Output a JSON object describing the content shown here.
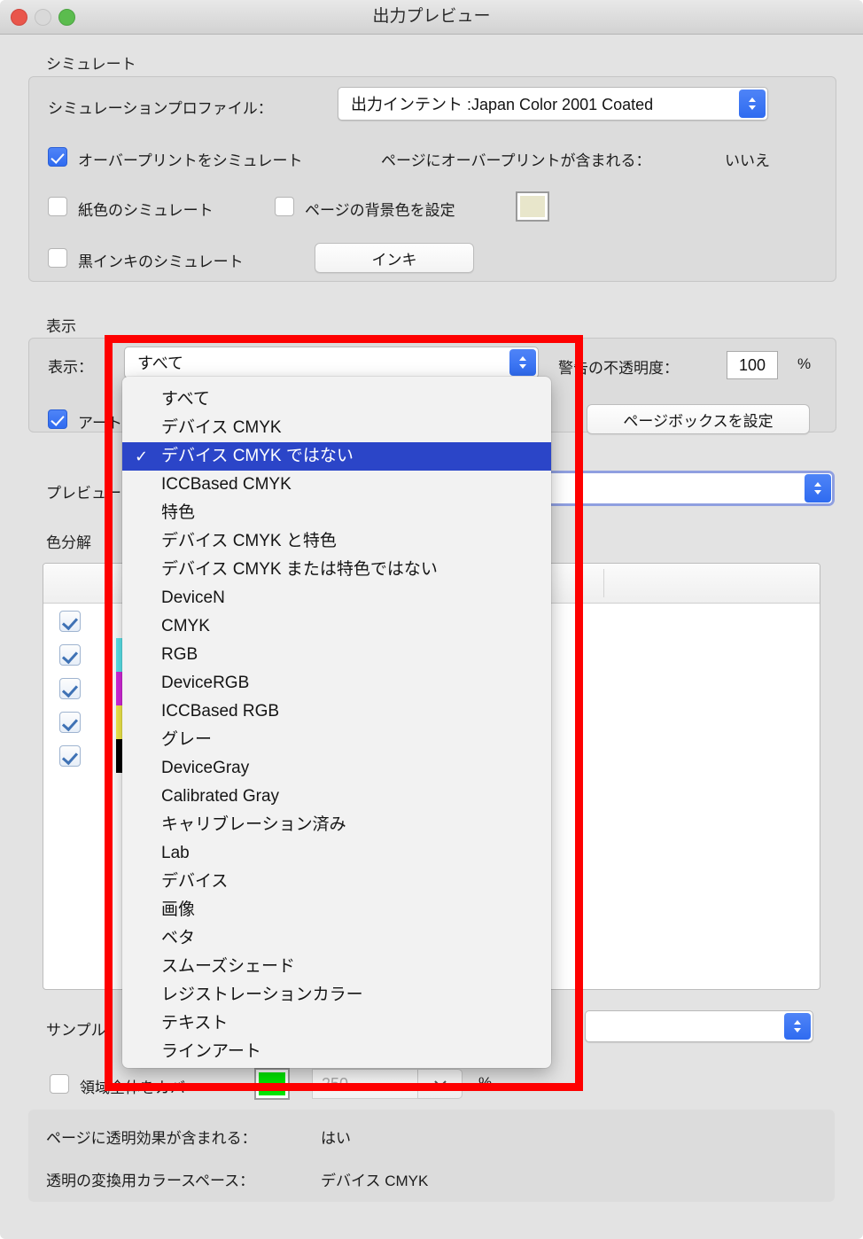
{
  "window": {
    "title": "出力プレビュー",
    "traffic_lights": [
      "close",
      "minimize",
      "zoom"
    ]
  },
  "simulate": {
    "group_label": "シミュレート",
    "profile_label": "シミュレーションプロファイル：",
    "profile_value": "出力インテント :Japan Color 2001 Coated",
    "overprint_checkbox_label": "オーバープリントをシミュレート",
    "overprint_checked": true,
    "page_has_overprint_label": "ページにオーバープリントが含まれる：",
    "page_has_overprint_value": "いいえ",
    "paper_color_label": "紙色のシミュレート",
    "paper_color_checked": false,
    "page_bg_label": "ページの背景色を設定",
    "page_bg_checked": false,
    "page_bg_color": "#e8e6cb",
    "black_ink_label": "黒インキのシミュレート",
    "black_ink_checked": false,
    "ink_button_label": "インキ"
  },
  "display": {
    "group_label": "表示",
    "show_label": "表示：",
    "show_value": "すべて",
    "warn_opacity_label": "警告の不透明度：",
    "warn_opacity_value": "100",
    "percent_label": "%",
    "artbox_checkbox_label": "アート",
    "artbox_checked": true,
    "page_box_button_label": "ページボックスを設定"
  },
  "preview": {
    "label": "プレビュー",
    "value": ""
  },
  "separations": {
    "group_label": "色分解",
    "rows": [
      {
        "checked": true,
        "color": "#ffffff"
      },
      {
        "checked": true,
        "color": "#5ce8ef"
      },
      {
        "checked": true,
        "color": "#d829e0"
      },
      {
        "checked": true,
        "color": "#f7ef4a"
      },
      {
        "checked": true,
        "color": "#000000"
      }
    ]
  },
  "sample": {
    "label": "サンプル",
    "value": "",
    "total_coverage_label": "領域全体をカバー",
    "total_coverage_checked": false,
    "coverage_color": "#00e400",
    "coverage_value": "250",
    "coverage_percent": "%"
  },
  "footer": {
    "transparency_label": "ページに透明効果が含まれる：",
    "transparency_value": "はい",
    "blend_space_label": "透明の変換用カラースペース：",
    "blend_space_value": "デバイス CMYK"
  },
  "dropdown_menu": {
    "selected_index": 2,
    "items": [
      "すべて",
      "デバイス CMYK",
      "デバイス CMYK ではない",
      "ICCBased CMYK",
      "特色",
      "デバイス CMYK と特色",
      "デバイス CMYK または特色ではない",
      "DeviceN",
      "CMYK",
      "RGB",
      "DeviceRGB",
      "ICCBased RGB",
      "グレー",
      "DeviceGray",
      "Calibrated Gray",
      "キャリブレーション済み",
      "Lab",
      "デバイス",
      "画像",
      "ベタ",
      "スムーズシェード",
      "レジストレーションカラー",
      "テキスト",
      "ラインアート"
    ],
    "check_glyph": "✓"
  },
  "annotation": {
    "color": "#fe0000"
  }
}
